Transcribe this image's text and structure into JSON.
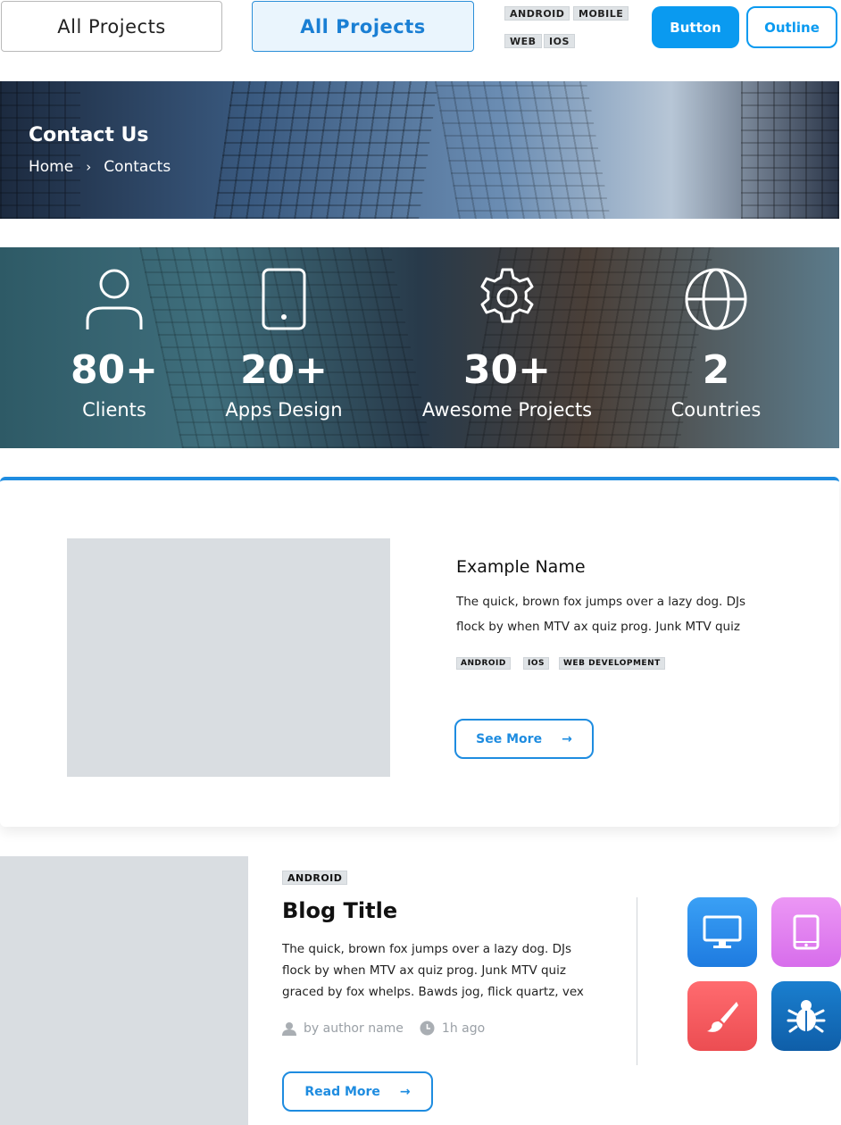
{
  "top_controls": {
    "filter_button_default": "All Projects",
    "filter_button_active": "All Projects",
    "tags": [
      "ANDROID",
      "MOBILE",
      "WEB",
      "IOS"
    ],
    "button_label": "Button",
    "outline_label": "Outline"
  },
  "hero": {
    "title": "Contact Us",
    "breadcrumb": {
      "home": "Home",
      "separator": "›",
      "current": "Contacts"
    }
  },
  "stats": [
    {
      "icon": "user-icon",
      "value": "80+",
      "label": "Clients"
    },
    {
      "icon": "phone-icon",
      "value": "20+",
      "label": "Apps Design"
    },
    {
      "icon": "gear-icon",
      "value": "30+",
      "label": "Awesome Projects"
    },
    {
      "icon": "globe-icon",
      "value": "2",
      "label": "Countries"
    }
  ],
  "project_card": {
    "name": "Example Name",
    "text": "The quick, brown fox jumps over a lazy dog. DJs flock by when MTV ax quiz prog. Junk MTV quiz",
    "tags": [
      "ANDROID",
      "IOS",
      "WEB DEVELOPMENT"
    ],
    "button_label": "See More",
    "arrow": "→"
  },
  "blog": {
    "tag": "ANDROID",
    "title": "Blog Title",
    "text": "The quick, brown fox jumps over a lazy dog. DJs flock by when MTV ax quiz prog. Junk MTV quiz graced by fox whelps. Bawds jog, flick quartz, vex",
    "author": "by author name",
    "time": "1h ago",
    "button_label": "Read More",
    "arrow": "→"
  },
  "app_icons": [
    {
      "icon": "monitor-icon",
      "color": "#2f8ff0"
    },
    {
      "icon": "tablet-icon",
      "color": "#e38af0"
    },
    {
      "icon": "brush-icon",
      "color": "#f05a5e"
    },
    {
      "icon": "bug-icon",
      "color": "#1670bf"
    }
  ]
}
